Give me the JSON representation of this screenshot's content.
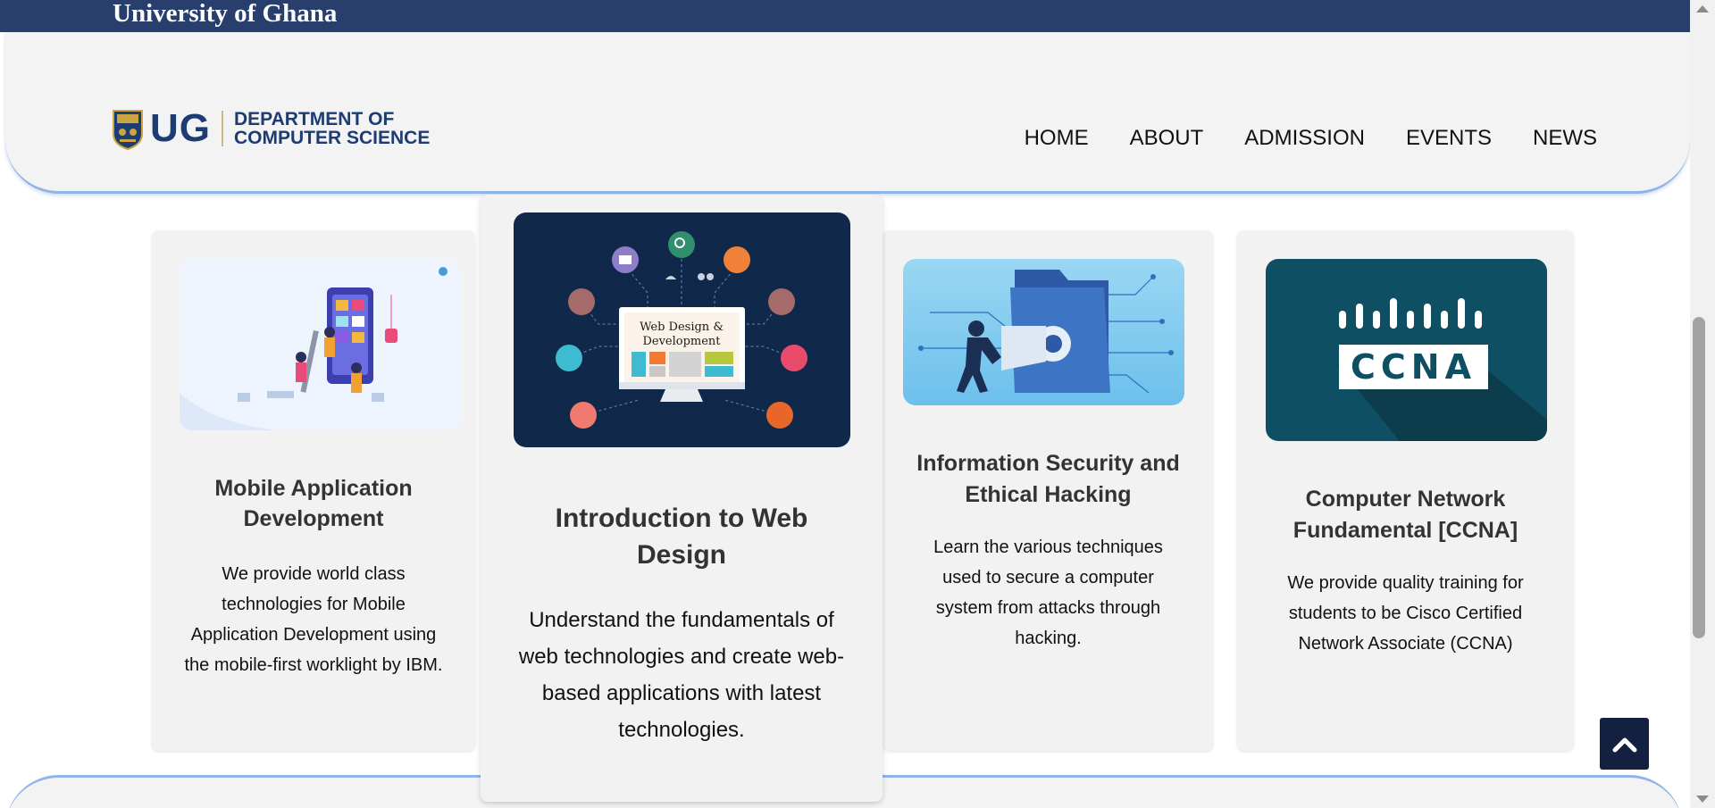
{
  "topbar": {
    "title": "University of Ghana"
  },
  "logo": {
    "short": "UG",
    "dept_line1": "DEPARTMENT OF",
    "dept_line2": "COMPUTER SCIENCE"
  },
  "nav": {
    "items": [
      "HOME",
      "ABOUT",
      "ADMISSION",
      "EVENTS",
      "NEWS"
    ]
  },
  "cards": [
    {
      "title": "Mobile Application Development",
      "description": "We provide world class technologies for Mobile Application Development using the mobile-first worklight by IBM.",
      "image_icon": "mobile-app-illustration"
    },
    {
      "title": "Introduction to Web Design",
      "description": "Understand the fundamentals of web technologies and create web-based applications with latest technologies.",
      "image_icon": "web-design-illustration",
      "image_text_line1": "Web Design &",
      "image_text_line2": "Development"
    },
    {
      "title": "Information Security and Ethical Hacking",
      "description": "Learn the various techniques used to secure a computer system from attacks through hacking.",
      "image_icon": "security-illustration"
    },
    {
      "title": "Computer Network Fundamental [CCNA]",
      "description": "We provide quality training for students to be Cisco Certified Network Associate (CCNA)",
      "image_icon": "ccna-logo",
      "image_text": "CCNA"
    }
  ],
  "colors": {
    "topbar": "#283f6e",
    "brand_blue": "#1d3c73",
    "header_bg": "#f3f3f3",
    "accent_border": "#8fb4ea",
    "back_to_top": "#13203f"
  },
  "back_to_top_icon": "chevron-up-icon"
}
